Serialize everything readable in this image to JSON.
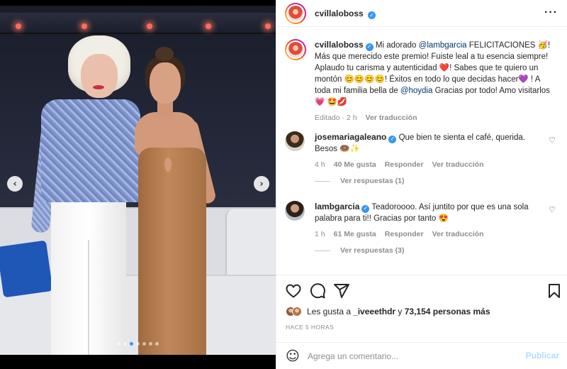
{
  "post": {
    "author": "cvillaloboss",
    "caption": {
      "username": "cvillaloboss",
      "parts": [
        {
          "t": "Mi adorado ",
          "m": false
        },
        {
          "t": "@lambgarcia",
          "m": true
        },
        {
          "t": " FELICITACIONES 🥳! Más que merecido este premio! Fuiste leal a tu esencia siempre! Aplaudo tu carisma y autenticidad ❤️! Sabes que te quiero un montón 😊😊😊😊! Éxitos en todo lo que decidas hacer💜 ! A toda mi familia bella de ",
          "m": false
        },
        {
          "t": "@hoydia",
          "m": true
        },
        {
          "t": " Gracias por todo! Amo visitarlos 💗 🤩💋",
          "m": false
        }
      ],
      "edited": "Editado · 2 h",
      "translate": "Ver traducción"
    },
    "comments": [
      {
        "username": "josemariagaleano",
        "text": "Que bien te sienta el café, querida. Besos 🍩✨",
        "time": "4 h",
        "likes": "40 Me gusta",
        "reply": "Responder",
        "translate": "Ver traducción",
        "replies": "Ver respuestas (1)"
      },
      {
        "username": "lambgarcia",
        "text": "Teadoroooo. Así juntito por que es una sola palabra para ti!! Gracias por tanto 😍",
        "time": "1 h",
        "likes": "61 Me gusta",
        "reply": "Responder",
        "translate": "Ver traducción",
        "replies": "Ver respuestas (3)"
      }
    ],
    "likes_prefix": "Les gusta a ",
    "likes_user": "_iveeethdr",
    "likes_conj": " y ",
    "likes_count": "73,154 personas más",
    "time_ago": "HACE 5 HORAS",
    "comment_placeholder": "Agrega un comentario...",
    "publish_label": "Publicar"
  },
  "carousel": {
    "slide_count": 7,
    "active_index": 2
  },
  "colors": {
    "accent": "#3897f0",
    "publish_disabled": "#b3dbff",
    "mention": "#00376b",
    "muted": "#8e8e8e"
  },
  "icons": [
    "more-icon",
    "heart-icon",
    "comment-icon",
    "share-icon",
    "bookmark-icon",
    "emoji-icon",
    "verified-icon",
    "chevron-left-icon",
    "chevron-right-icon"
  ]
}
